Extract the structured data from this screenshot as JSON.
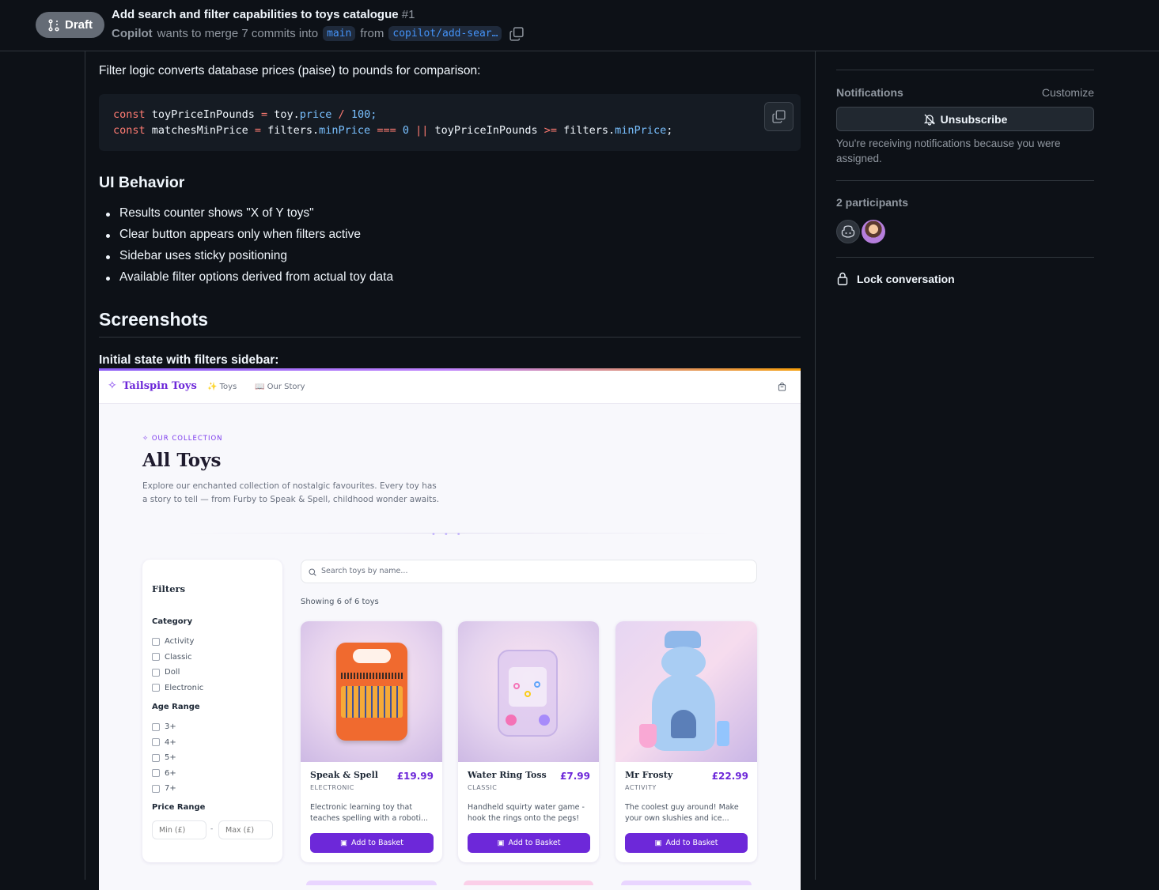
{
  "header": {
    "badge": "Draft",
    "title": "Add search and filter capabilities to toys catalogue",
    "number": "#1",
    "author": "Copilot",
    "merge_text": "wants to merge 7 commits into",
    "base_branch": "main",
    "from_text": "from",
    "head_branch": "copilot/add-sear…"
  },
  "body": {
    "filter_logic_text": "Filter logic converts database prices (paise) to pounds for comparison:",
    "code": {
      "line1": {
        "kw": "const",
        "var": "toyPriceInPounds",
        "eq": "=",
        "obj": "toy.",
        "prop": "price",
        "op": "/",
        "num": "100;"
      },
      "line2": {
        "kw": "const",
        "var": "matchesMinPrice",
        "eq": "=",
        "obj": "filters.",
        "prop": "minPrice",
        "op": "===",
        "num": "0",
        "or": "||",
        "var2": "toyPriceInPounds",
        "ge": ">=",
        "obj2": "filters.",
        "prop2": "minPrice",
        "end": ";"
      }
    },
    "ui_heading": "UI Behavior",
    "ui_items": [
      "Results counter shows \"X of Y toys\"",
      "Clear button appears only when filters active",
      "Sidebar uses sticky positioning",
      "Available filter options derived from actual toy data"
    ],
    "screenshots_heading": "Screenshots",
    "initial_state": "Initial state with filters sidebar:"
  },
  "app": {
    "brand": "Tailspin Toys",
    "nav_toys": "✨ Toys",
    "nav_story": "📖 Our Story",
    "eyebrow": "OUR COLLECTION",
    "title": "All Toys",
    "desc1": "Explore our enchanted collection of nostalgic favourites. Every toy has",
    "desc2": "a story to tell — from Furby to Speak & Spell, childhood wonder awaits.",
    "filters_title": "Filters",
    "category_label": "Category",
    "categories": [
      "Activity",
      "Classic",
      "Doll",
      "Electronic"
    ],
    "age_label": "Age Range",
    "ages": [
      "3+",
      "4+",
      "5+",
      "6+",
      "7+"
    ],
    "price_label": "Price Range",
    "min_placeholder": "Min (£)",
    "max_placeholder": "Max (£)",
    "dash": "-",
    "search_placeholder": "Search toys by name...",
    "showing": "Showing 6 of 6 toys",
    "cards": [
      {
        "name": "Speak & Spell",
        "price": "£19.99",
        "category": "ELECTRONIC",
        "desc1": "Electronic learning toy that",
        "desc2": "teaches spelling with a roboti...",
        "button": "Add to Basket"
      },
      {
        "name": "Water Ring Toss",
        "price": "£7.99",
        "category": "CLASSIC",
        "desc1": "Handheld squirty water game -",
        "desc2": "hook the rings onto the pegs!",
        "button": "Add to Basket"
      },
      {
        "name": "Mr Frosty",
        "price": "£22.99",
        "category": "ACTIVITY",
        "desc1": "The coolest guy around! Make",
        "desc2": "your own slushies and ice...",
        "button": "Add to Basket"
      }
    ]
  },
  "sidebar": {
    "notifications": "Notifications",
    "customize": "Customize",
    "unsubscribe": "Unsubscribe",
    "notif_reason1": "You're receiving notifications because you were",
    "notif_reason2": "assigned.",
    "participants": "2 participants",
    "lock": "Lock conversation"
  }
}
